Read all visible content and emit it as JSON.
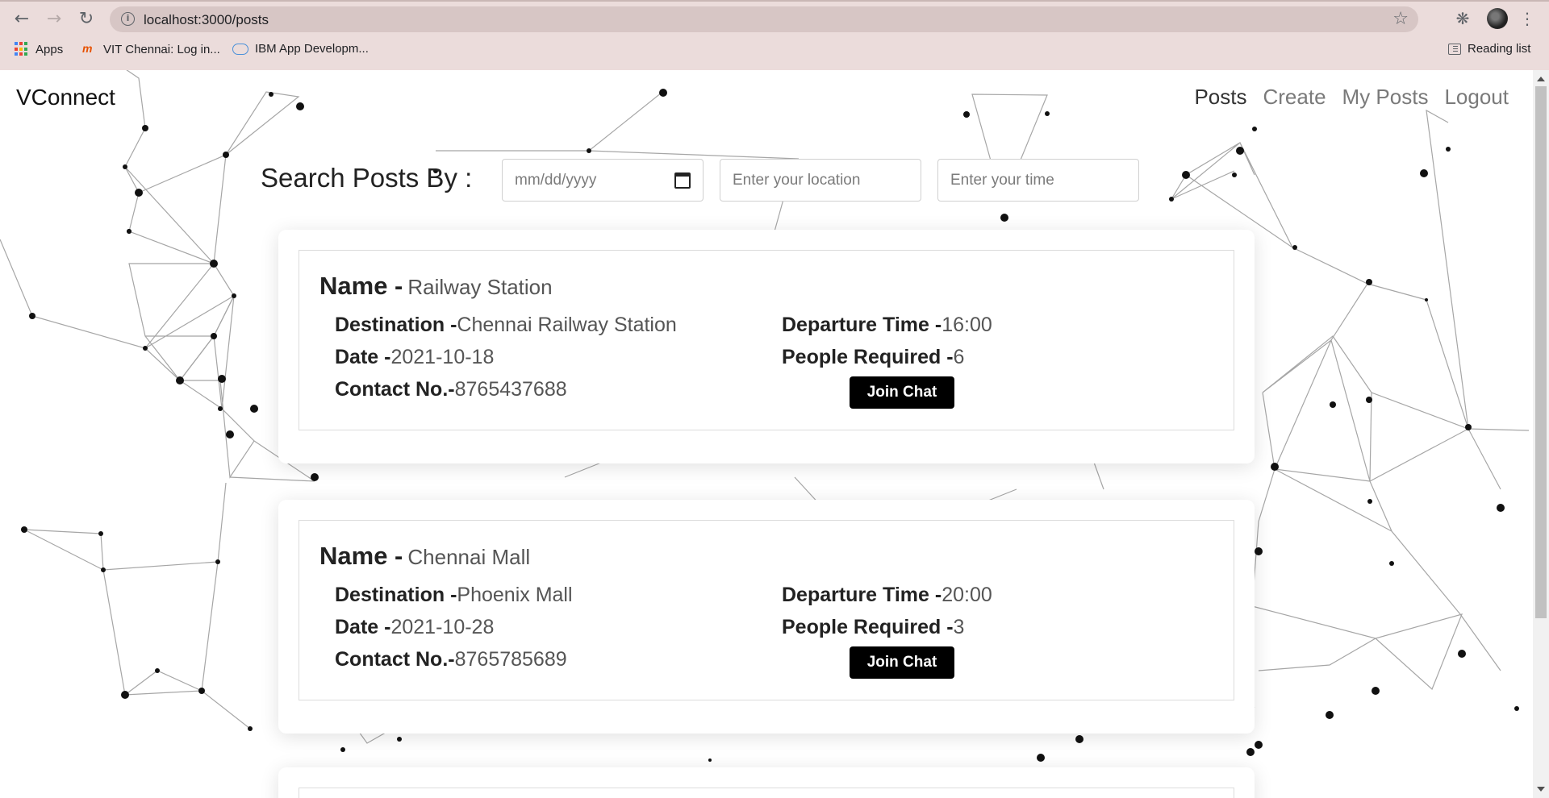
{
  "browser": {
    "url": "localhost:3000/posts",
    "bookmarks": [
      {
        "label": "Apps",
        "icon": "apps-grid-icon"
      },
      {
        "label": "VIT Chennai: Log in...",
        "icon": "vit-icon"
      },
      {
        "label": "IBM App Developm...",
        "icon": "ibm-cloud-icon"
      }
    ],
    "reading_list": "Reading list"
  },
  "header": {
    "brand": "VConnect",
    "nav": [
      {
        "label": "Posts",
        "active": true
      },
      {
        "label": "Create",
        "active": false
      },
      {
        "label": "My Posts",
        "active": false
      },
      {
        "label": "Logout",
        "active": false
      }
    ]
  },
  "search": {
    "label": "Search Posts By :",
    "date_placeholder": "mm/dd/yyyy",
    "location_placeholder": "Enter your location",
    "time_placeholder": "Enter your time"
  },
  "labels": {
    "name": "Name -",
    "destination": "Destination -",
    "date": "Date -",
    "contact": "Contact No.-",
    "departure": "Departure Time -",
    "people": "People Required -",
    "join": "Join Chat"
  },
  "posts": [
    {
      "name": "Railway Station",
      "destination": "Chennai Railway Station",
      "date": "2021-10-18",
      "contact": "8765437688",
      "departure_time": "16:00",
      "people_required": "6"
    },
    {
      "name": "Chennai Mall",
      "destination": "Phoenix Mall",
      "date": "2021-10-28",
      "contact": "8765785689",
      "departure_time": "20:00",
      "people_required": "3"
    }
  ]
}
